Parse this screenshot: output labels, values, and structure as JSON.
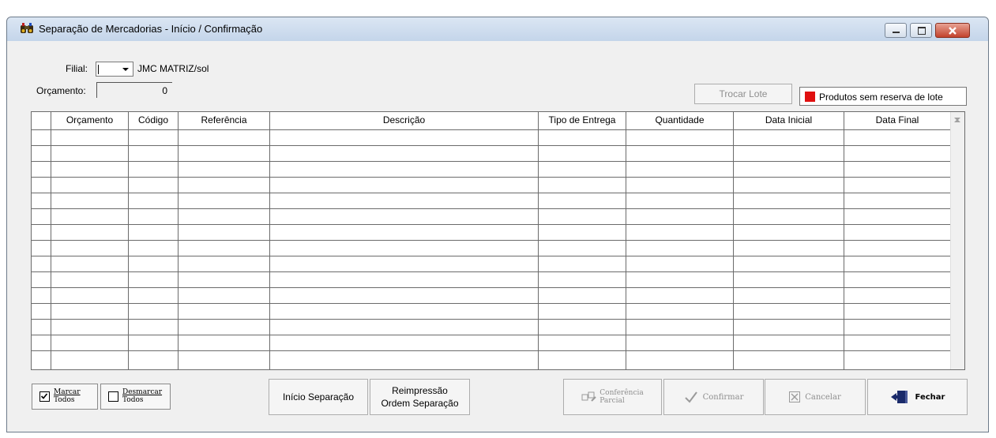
{
  "window": {
    "title": "Separação de Mercadorias - Início / Confirmação",
    "icon": "binoculars-app-icon",
    "controls": [
      "minimize-icon",
      "maximize-icon",
      "close-icon"
    ]
  },
  "filters": {
    "filial_label": "Filial:",
    "filial_value": "",
    "filial_name": "JMC MATRIZ/sol",
    "orcamento_label": "Orçamento:",
    "orcamento_value": "0"
  },
  "toolbar": {
    "trocar_lote": "Trocar Lote",
    "legend_text": "Produtos sem reserva de lote",
    "legend_color": "#e01010"
  },
  "table": {
    "columns": [
      "Orçamento",
      "Código",
      "Referência",
      "Descrição",
      "Tipo de Entrega",
      "Quantidade",
      "Data Inicial",
      "Data Final"
    ]
  },
  "footer": {
    "marcar_line1": "Marcar",
    "marcar_line2": "Todos",
    "desmarcar_line1": "Desmarcar",
    "desmarcar_line2": "Todos",
    "inicio_separacao": "Início Separação",
    "reimpressao_line1": "Reimpressão",
    "reimpressao_line2": "Ordem Separação",
    "conferencia_line1": "Conferência",
    "conferencia_line2": "Parcial",
    "confirmar": "Confirmar",
    "cancelar": "Cancelar",
    "fechar": "Fechar"
  }
}
